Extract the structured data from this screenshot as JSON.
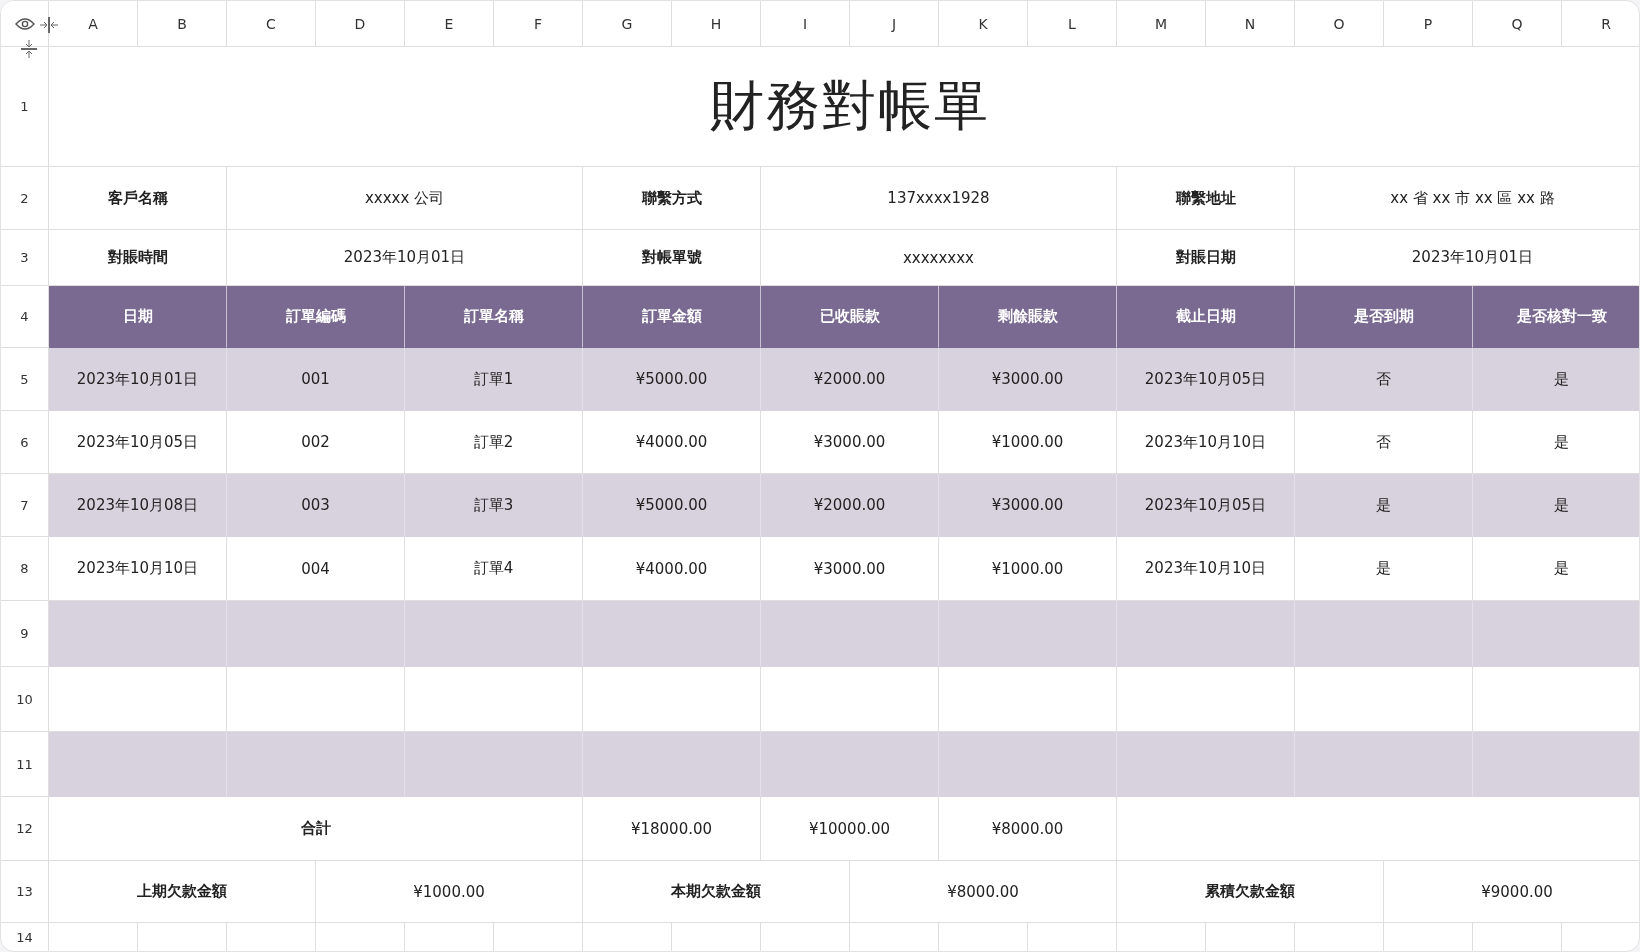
{
  "column_headers": [
    "A",
    "B",
    "C",
    "D",
    "E",
    "F",
    "G",
    "H",
    "I",
    "J",
    "K",
    "L",
    "M",
    "N",
    "O",
    "P",
    "Q",
    "R"
  ],
  "row_headers": [
    "1",
    "2",
    "3",
    "4",
    "5",
    "6",
    "7",
    "8",
    "9",
    "10",
    "11",
    "12",
    "13",
    "14"
  ],
  "title": "財務對帳單",
  "info_rows": [
    {
      "cells": [
        {
          "kind": "label",
          "text": "客戶名稱"
        },
        {
          "kind": "value",
          "text": "xxxxx 公司"
        },
        {
          "kind": "label",
          "text": "聯繫方式"
        },
        {
          "kind": "value",
          "text": "137xxxx1928"
        },
        {
          "kind": "label",
          "text": "聯繫地址"
        },
        {
          "kind": "value",
          "text": "xx 省 xx 市 xx 區 xx 路"
        }
      ]
    },
    {
      "cells": [
        {
          "kind": "label",
          "text": "對賬時間"
        },
        {
          "kind": "value",
          "text": "2023年10月01日"
        },
        {
          "kind": "label",
          "text": "對帳單號"
        },
        {
          "kind": "value",
          "text": "xxxxxxxx"
        },
        {
          "kind": "label",
          "text": "對賬日期"
        },
        {
          "kind": "value",
          "text": "2023年10月01日"
        }
      ]
    }
  ],
  "table": {
    "columns": [
      "日期",
      "訂單編碼",
      "訂單名稱",
      "訂單金額",
      "已收賬款",
      "剩餘賬款",
      "截止日期",
      "是否到期",
      "是否核對一致"
    ],
    "rows": [
      {
        "shaded": true,
        "cells": [
          "2023年10月01日",
          "001",
          "訂單1",
          "¥5000.00",
          "¥2000.00",
          "¥3000.00",
          "2023年10月05日",
          "否",
          "是"
        ]
      },
      {
        "shaded": false,
        "cells": [
          "2023年10月05日",
          "002",
          "訂單2",
          "¥4000.00",
          "¥3000.00",
          "¥1000.00",
          "2023年10月10日",
          "否",
          "是"
        ]
      },
      {
        "shaded": true,
        "cells": [
          "2023年10月08日",
          "003",
          "訂單3",
          "¥5000.00",
          "¥2000.00",
          "¥3000.00",
          "2023年10月05日",
          "是",
          "是"
        ]
      },
      {
        "shaded": false,
        "cells": [
          "2023年10月10日",
          "004",
          "訂單4",
          "¥4000.00",
          "¥3000.00",
          "¥1000.00",
          "2023年10月10日",
          "是",
          "是"
        ]
      },
      {
        "shaded": true
      },
      {
        "shaded": false
      },
      {
        "shaded": true
      }
    ]
  },
  "totals": {
    "label": "合計",
    "values": [
      "¥18000.00",
      "¥10000.00",
      "¥8000.00"
    ]
  },
  "summary": [
    {
      "label": "上期欠款金額",
      "value": "¥1000.00"
    },
    {
      "label": "本期欠款金額",
      "value": "¥8000.00"
    },
    {
      "label": "累積欠款金額",
      "value": "¥9000.00"
    }
  ]
}
